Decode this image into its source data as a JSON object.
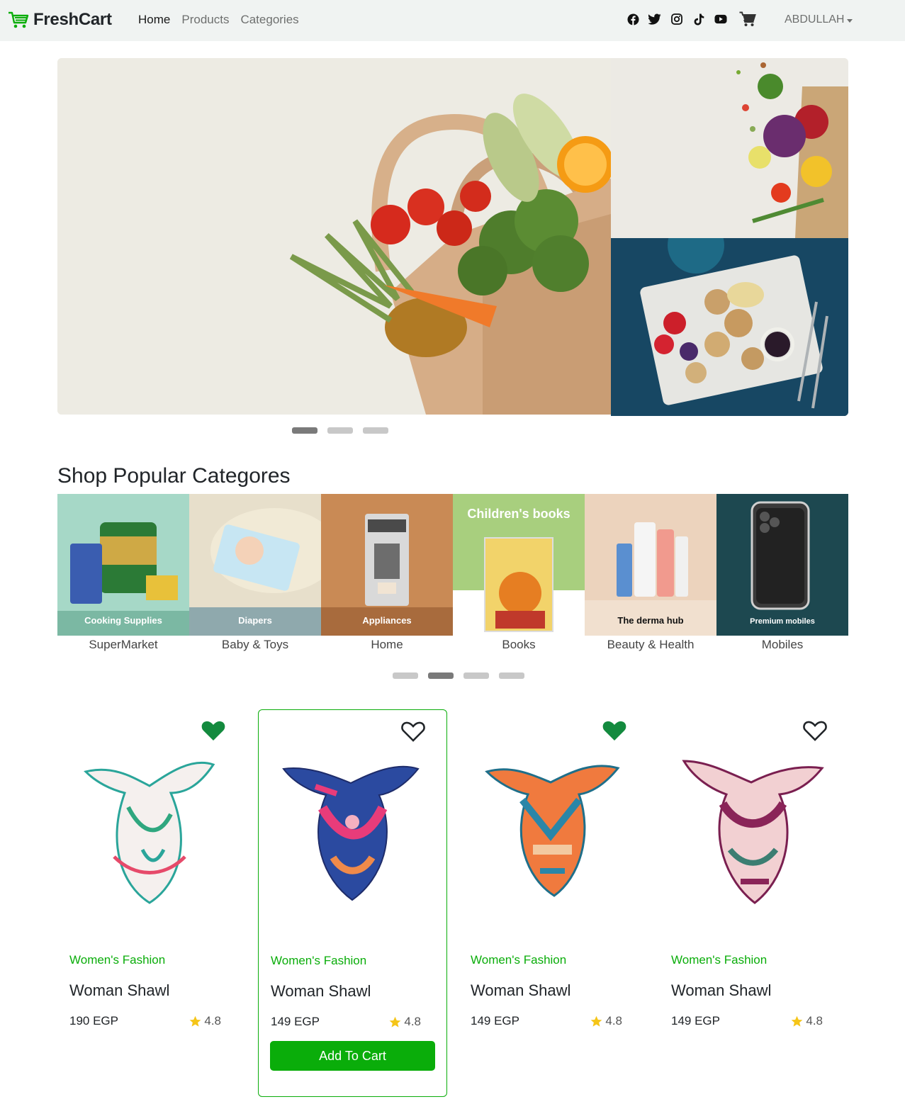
{
  "navbar": {
    "brand": "FreshCart",
    "links": [
      {
        "label": "Home",
        "active": true
      },
      {
        "label": "Products",
        "active": false
      },
      {
        "label": "Categories",
        "active": false
      }
    ],
    "social_icons": [
      "facebook-icon",
      "twitter-icon",
      "instagram-icon",
      "tiktok-icon",
      "youtube-icon"
    ],
    "user": "ABDULLAH"
  },
  "colors": {
    "accent": "#0aad0a",
    "navbar_bg": "#f0f3f2",
    "heart_filled": "#138a3e"
  },
  "categories_section": {
    "title": "Shop Popular Categores",
    "items": [
      {
        "label": "SuperMarket",
        "image_text": "Cooking Supplies"
      },
      {
        "label": "Baby & Toys",
        "image_text": "Diapers"
      },
      {
        "label": "Home",
        "image_text": "Appliances"
      },
      {
        "label": "Books",
        "image_text": "Children's books"
      },
      {
        "label": "Beauty & Health",
        "image_text": "The derma hub"
      },
      {
        "label": "Mobiles",
        "image_text": "Premium mobiles"
      }
    ]
  },
  "products": [
    {
      "category": "Women's Fashion",
      "name": "Woman Shawl",
      "price": "190 EGP",
      "rating": "4.8",
      "wishlisted": true
    },
    {
      "category": "Women's Fashion",
      "name": "Woman Shawl",
      "price": "149 EGP",
      "rating": "4.8",
      "wishlisted": false,
      "add_label": "Add To Cart"
    },
    {
      "category": "Women's Fashion",
      "name": "Woman Shawl",
      "price": "149 EGP",
      "rating": "4.8",
      "wishlisted": true
    },
    {
      "category": "Women's Fashion",
      "name": "Woman Shawl",
      "price": "149 EGP",
      "rating": "4.8",
      "wishlisted": false
    }
  ]
}
